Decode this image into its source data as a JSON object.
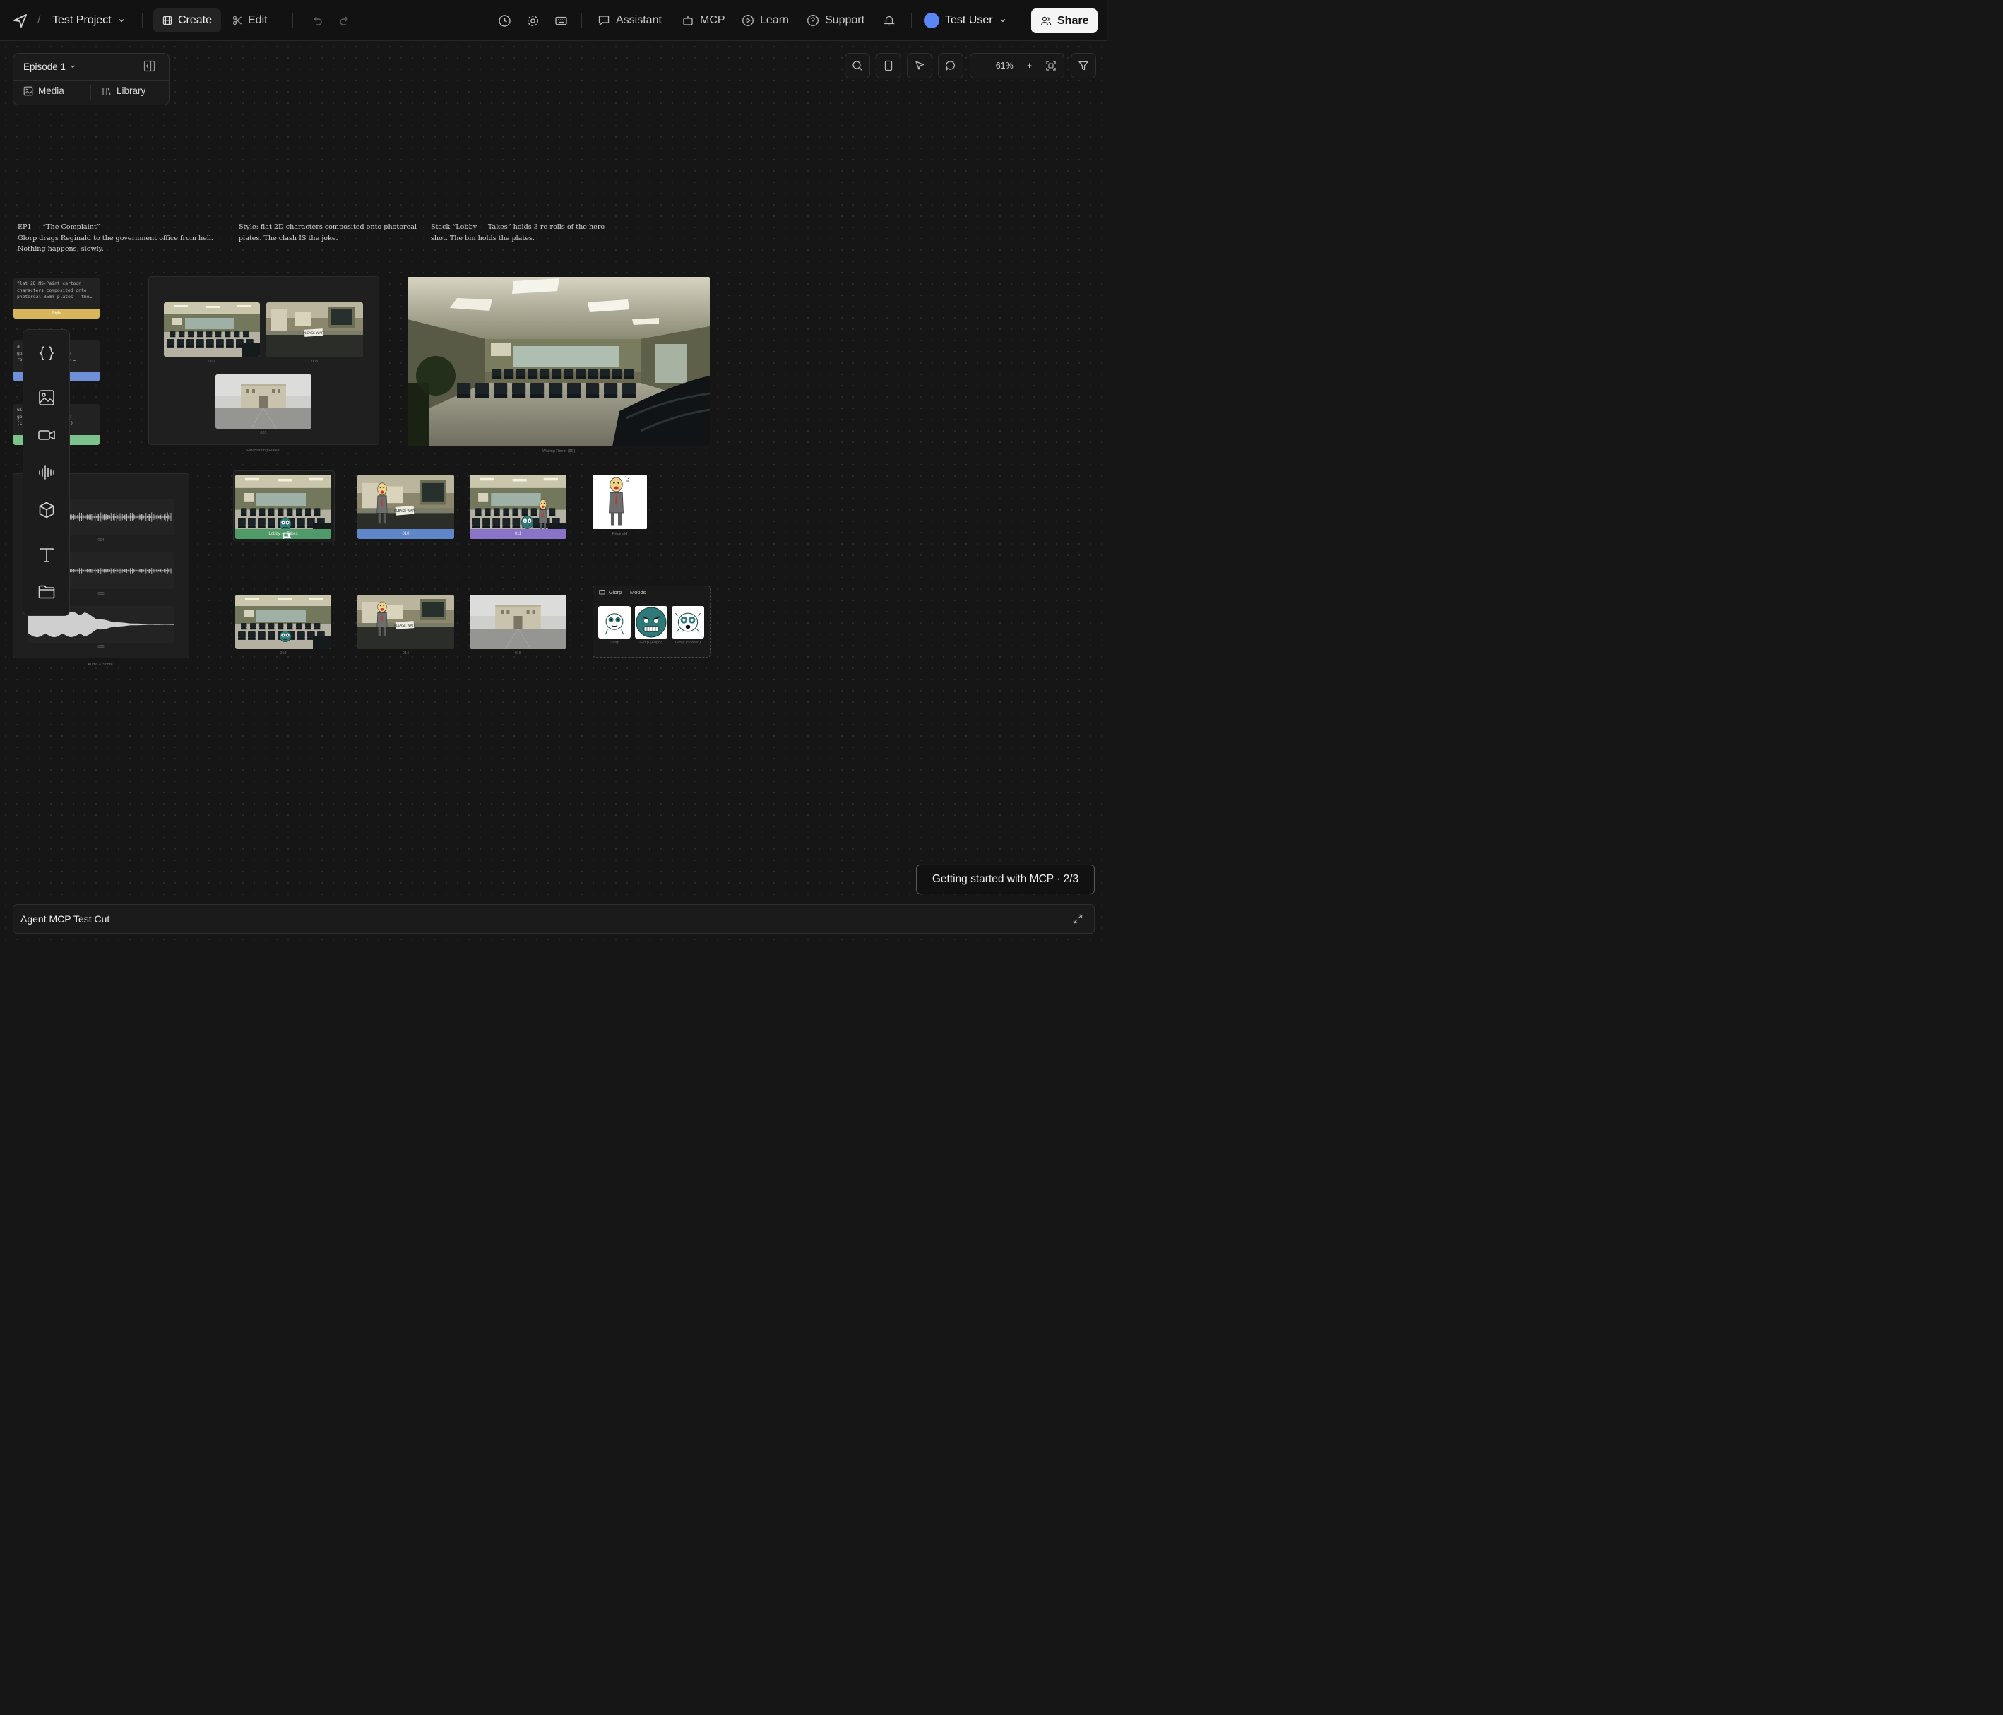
{
  "topbar": {
    "project_name": "Test Project",
    "breadcrumb_sep": "/",
    "create_label": "Create",
    "edit_label": "Edit",
    "assistant_label": "Assistant",
    "mcp_label": "MCP",
    "learn_label": "Learn",
    "support_label": "Support",
    "user_name": "Test User",
    "share_label": "Share"
  },
  "left_panel": {
    "episode_label": "Episode 1",
    "media_label": "Media",
    "library_label": "Library"
  },
  "canvas_toolbar": {
    "zoom_out": "–",
    "zoom_level": "61%",
    "zoom_in": "+"
  },
  "notes": {
    "ep_title": "EP1 — “The Complaint”",
    "ep_line2": "Glorp drags Reginald to the government office from hell.",
    "ep_line3": "Nothing happens, slowly.",
    "style_line1": "Style: flat 2D characters composited onto photoreal",
    "style_line2": "plates. The clash IS the joke.",
    "stack_line1": "Stack “Lobby — Takes” holds 3 re-rolls of the hero",
    "stack_line2": "shot. The bin holds the plates."
  },
  "prompt_cards": [
    {
      "text": "flat 2D MS-Paint cartoon\ncharacters composited onto\nphotoreal 35mm plates — the…",
      "tag": "Style",
      "color": "#d8b65c"
    },
    {
      "text": "a          -lit\ngo           waiting\nro           service …",
      "tag": "",
      "color": "#6f8fd6"
    },
    {
      "text": "Gl          blob,\ngo           eginald\n(c          ged suit)",
      "tag": "",
      "color": "#7cc28c"
    }
  ],
  "establishing": {
    "caption": "Establishing Plates",
    "thumbs": [
      {
        "label": "002",
        "scene": "lobby"
      },
      {
        "label": "003",
        "scene": "counter"
      },
      {
        "label": "001",
        "scene": "building"
      }
    ]
  },
  "hero": {
    "caption": "Waiting Room (3D)"
  },
  "shots_row1": [
    {
      "label": "Lobby — Takes",
      "color": "#4f9a68",
      "scene": "lobby-glorp"
    },
    {
      "label": "010",
      "color": "#5f86c9",
      "scene": "counter-reginald"
    },
    {
      "label": "011",
      "color": "#8a74c9",
      "scene": "lobby-both"
    }
  ],
  "reginald": {
    "caption": "Reginald"
  },
  "shots_row2": [
    {
      "label": "013",
      "scene": "lobby-glorp"
    },
    {
      "label": "014",
      "scene": "counter-reginald"
    },
    {
      "label": "015",
      "scene": "building"
    }
  ],
  "moods": {
    "title": "Glorp — Moods",
    "items": [
      {
        "caption": "Glorp",
        "mood": "neutral"
      },
      {
        "caption": "Glorp (Angry)",
        "mood": "angry"
      },
      {
        "caption": "Glorp (Scared)",
        "mood": "scared"
      }
    ]
  },
  "audio": {
    "caption": "Audio & Score",
    "tracks": [
      {
        "label": "004"
      },
      {
        "label": "005"
      },
      {
        "label": "006"
      }
    ]
  },
  "tools": [
    {
      "name": "code-icon"
    },
    {
      "name": "image-icon"
    },
    {
      "name": "video-icon"
    },
    {
      "name": "audio-icon"
    },
    {
      "name": "3d-icon"
    },
    {
      "name": "text-icon"
    },
    {
      "name": "folder-icon"
    }
  ],
  "getting_started": "Getting started with MCP · 2/3",
  "timeline": {
    "title": "Agent MCP Test Cut"
  }
}
